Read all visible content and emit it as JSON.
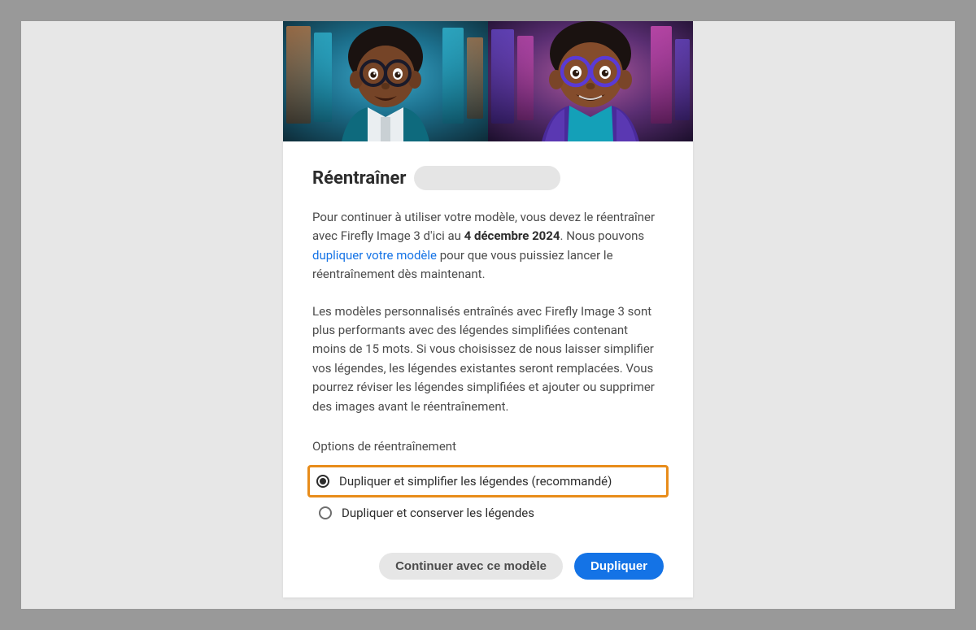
{
  "dialog": {
    "title": "Réentraîner",
    "description_parts": {
      "p1_a": "Pour continuer à utiliser votre modèle, vous devez le réentraîner avec Firefly Image 3 d'ici au ",
      "date_bold": "4 décembre 2024",
      "p1_b": ". Nous pouvons ",
      "link_text": "dupliquer votre modèle",
      "p1_c": " pour que vous puissiez lancer le réentraînement dès maintenant."
    },
    "paragraph2": "Les modèles personnalisés entraînés avec Firefly Image 3 sont plus performants avec des légendes simplifiées contenant moins de 15 mots. Si vous choisissez de nous laisser simplifier vos légendes, les légendes existantes seront remplacées. Vous pourrez réviser les légendes simplifiées et ajouter ou supprimer des images avant le réentraînement.",
    "options_heading": "Options de réentraînement",
    "options": [
      {
        "label": "Dupliquer et simplifier les légendes (recommandé)",
        "selected": true,
        "highlighted": true
      },
      {
        "label": "Dupliquer et conserver les légendes",
        "selected": false,
        "highlighted": false
      }
    ],
    "buttons": {
      "secondary": "Continuer avec ce modèle",
      "primary": "Dupliquer"
    }
  },
  "hero": {
    "description_left": "cartoon child with glasses, teal jacket, neon city background (orange/teal)",
    "description_right": "cartoon child with glasses, purple jacket, neon city background (pink/purple)"
  }
}
